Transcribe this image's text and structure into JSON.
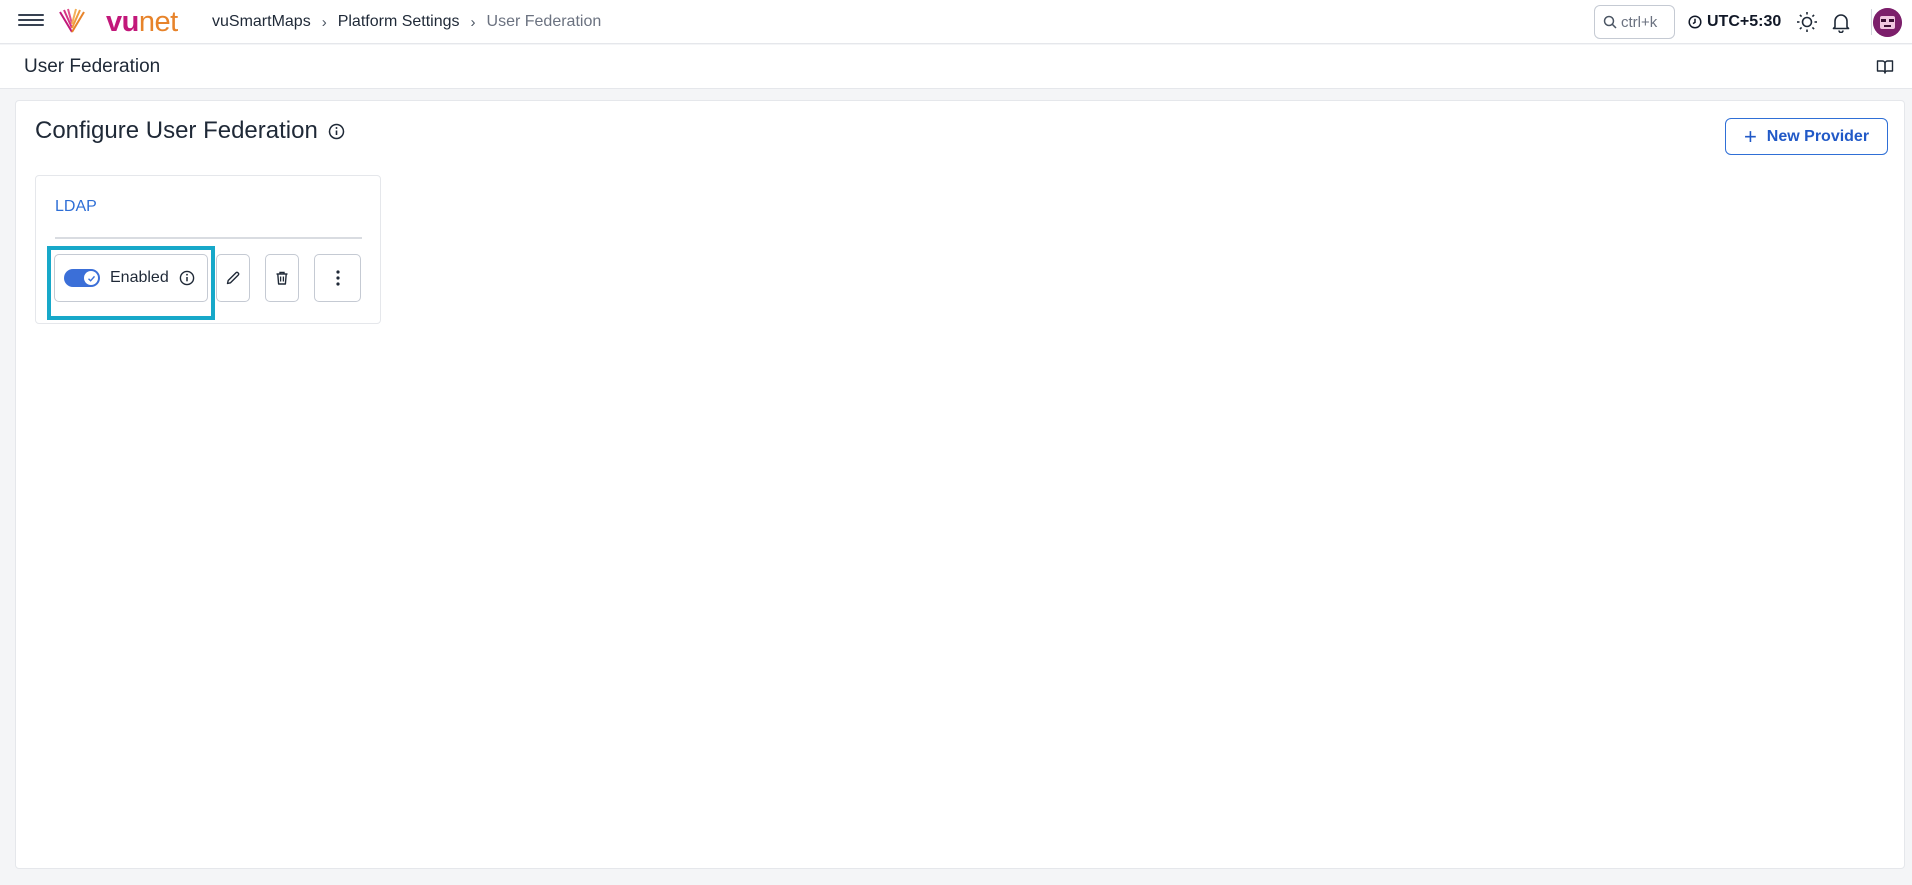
{
  "app": {
    "logo_vu": "vu",
    "logo_net": "net"
  },
  "breadcrumb": [
    {
      "label": "vuSmartMaps"
    },
    {
      "label": "Platform Settings"
    },
    {
      "label": "User Federation"
    }
  ],
  "topbar": {
    "search_placeholder": "ctrl+k",
    "timezone": "UTC+5:30"
  },
  "page": {
    "title": "User Federation"
  },
  "panel": {
    "title": "Configure User Federation",
    "new_provider_label": "New Provider"
  },
  "providers": [
    {
      "name": "LDAP",
      "status_label": "Enabled",
      "enabled": true
    }
  ],
  "colors": {
    "accent": "#2f6fd6",
    "toggle_on": "#3b6fd8",
    "highlight": "#17a8c9",
    "brand_magenta": "#c2187a",
    "brand_orange": "#e7832a"
  }
}
